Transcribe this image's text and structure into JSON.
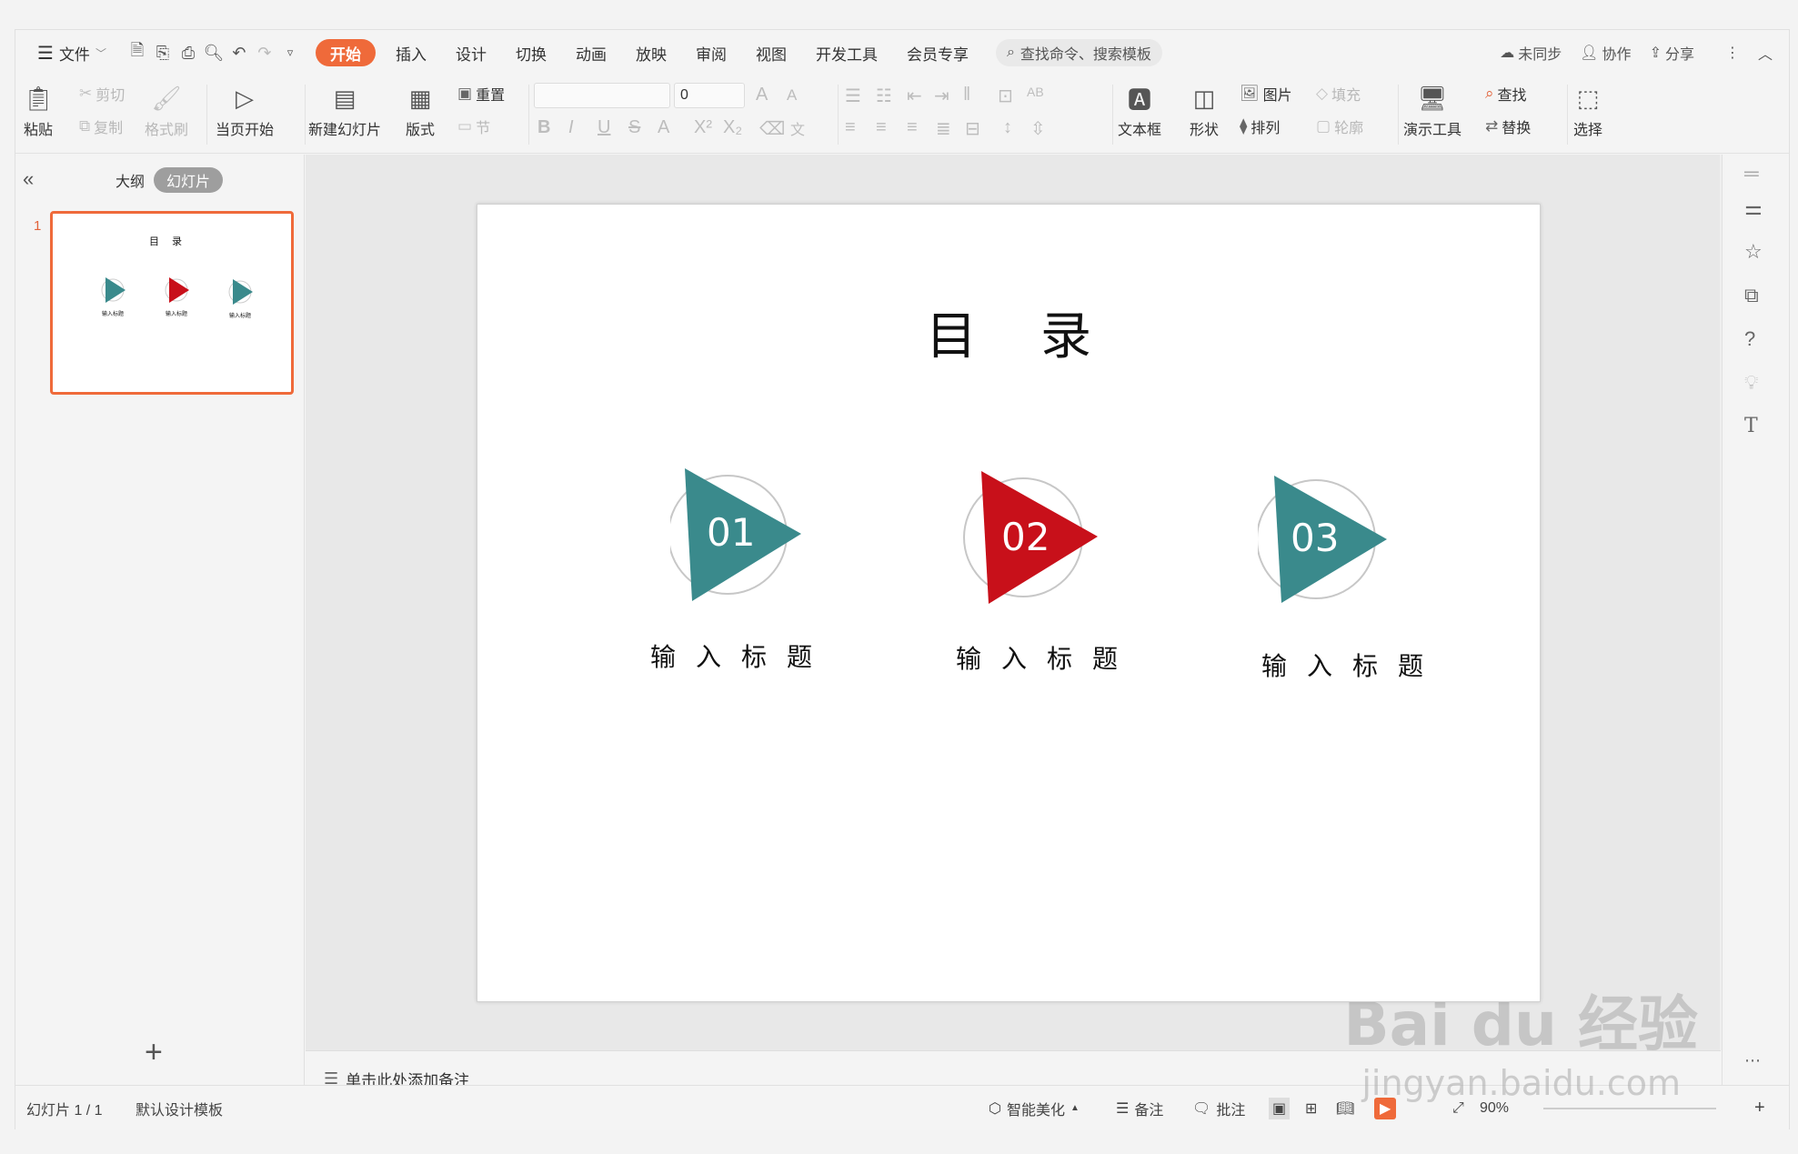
{
  "menubar": {
    "file": "文件",
    "tabs": [
      "开始",
      "插入",
      "设计",
      "切换",
      "动画",
      "放映",
      "审阅",
      "视图",
      "开发工具",
      "会员专享"
    ],
    "active_tab": "开始",
    "search_placeholder": "查找命令、搜索模板",
    "unsync": "未同步",
    "collab": "协作",
    "share": "分享"
  },
  "ribbon": {
    "paste": "粘贴",
    "cut": "剪切",
    "copy": "复制",
    "format_painter": "格式刷",
    "start_from_current": "当页开始",
    "new_slide": "新建幻灯片",
    "layout": "版式",
    "reset": "重置",
    "section": "节",
    "font_size": "0",
    "textbox": "文本框",
    "shape": "形状",
    "picture": "图片",
    "fill": "填充",
    "arrange": "排列",
    "outline": "轮廓",
    "presentation_tools": "演示工具",
    "find": "查找",
    "replace": "替换",
    "select": "选择"
  },
  "left_panel": {
    "tab_outline": "大纲",
    "tab_slides": "幻灯片",
    "slide_number": "1"
  },
  "slide": {
    "title": "目录",
    "items": [
      {
        "num": "01",
        "label": "输入标题",
        "color": "#3a8a8c"
      },
      {
        "num": "02",
        "label": "输入标题",
        "color": "#c8101a"
      },
      {
        "num": "03",
        "label": "输入标题",
        "color": "#3a8a8c"
      }
    ]
  },
  "notes": {
    "placeholder": "单击此处添加备注"
  },
  "status": {
    "slide_count": "幻灯片 1 / 1",
    "template": "默认设计模板",
    "beautify": "智能美化",
    "notes": "备注",
    "comments": "批注",
    "zoom": "90%"
  },
  "watermark": {
    "brand": "Bai du 经验",
    "url": "jingyan.baidu.com"
  }
}
